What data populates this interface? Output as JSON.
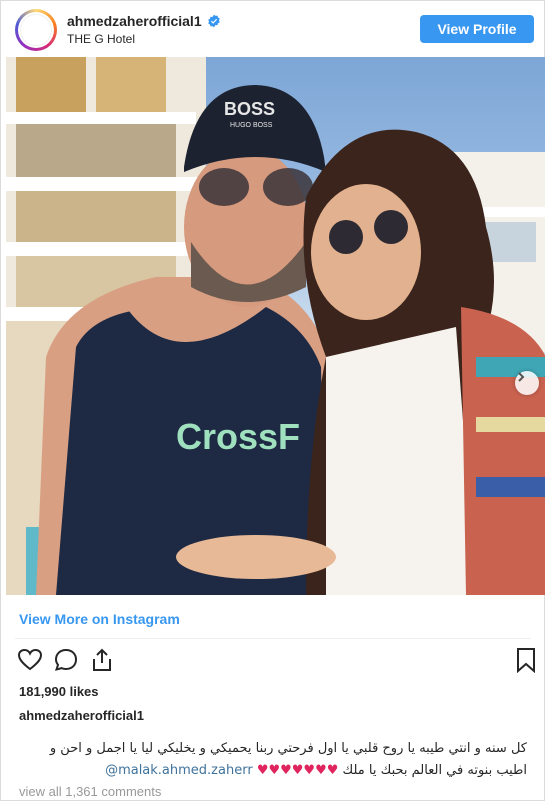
{
  "header": {
    "username": "ahmedzaherofficial1",
    "location": "THE G Hotel",
    "view_profile_label": "View Profile"
  },
  "photo": {
    "cap_text": "BOSS",
    "cap_subtext": "HUGO BOSS",
    "shirt_text": "CrossF",
    "carousel_count": 2,
    "carousel_active": 1
  },
  "view_more_label": "View More on Instagram",
  "likes_text": "181,990 likes",
  "caption": {
    "username": "ahmedzaherofficial1",
    "line1": "كل سنه و انتي طيبه يا روح قلبي يا اول فرحتي ربنا يحميكي و يخليكي ليا يا اجمل و احن و",
    "line2": "اطيب بنوته في العالم بحبك يا ملك",
    "hearts": "♥♥♥♥♥♥♥",
    "mention": "@malak.ahmed.zaherr"
  },
  "comments_text": "view all 1,361 comments",
  "colors": {
    "accent": "#3897f0",
    "mention": "#3f729b",
    "heart": "#e0245e"
  }
}
